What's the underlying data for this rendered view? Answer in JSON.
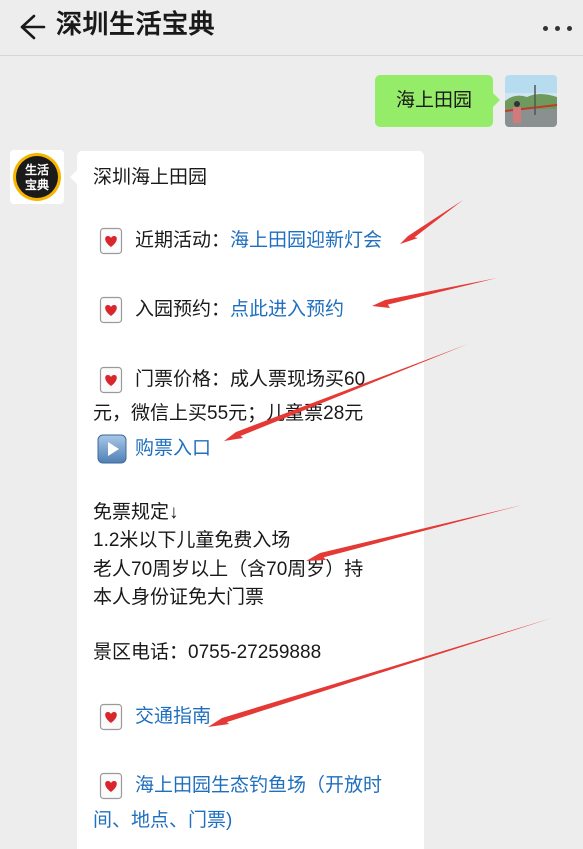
{
  "header": {
    "title": "深圳生活宝典",
    "back_icon": "back-arrow-icon",
    "more_icon": "more-dots-icon"
  },
  "chat": {
    "user_message": "海上田园",
    "bot_avatar_text_line1": "生活",
    "bot_avatar_text_line2": "宝典",
    "reply": {
      "heading": "深圳海上田园",
      "activity_label": "近期活动：",
      "activity_link": "海上田园迎新灯会",
      "reserve_label": "入园预约：",
      "reserve_link": "点此进入预约",
      "price_line1": "门票价格：成人票现场买60",
      "price_line2": "元，微信上买55元；儿童票28元",
      "ticket_link": "购票入口",
      "free_rules_title": "免票规定↓",
      "free_rule1": "1.2米以下儿童免费入场",
      "free_rule2_line1": "老人70周岁以上（含70周岁）持",
      "free_rule2_line2": "本人身份证免大门票",
      "phone": "景区电话：0755-27259888",
      "traffic_link": "交通指南",
      "fishing_link_line1": "海上田园生态钓鱼场（开放时",
      "fishing_link_line2": "间、地点、门票)"
    }
  },
  "colors": {
    "bubble_green": "#95ec69",
    "link_blue": "#1f6fbf",
    "arrow_red": "#e53935",
    "background": "#ededed"
  }
}
